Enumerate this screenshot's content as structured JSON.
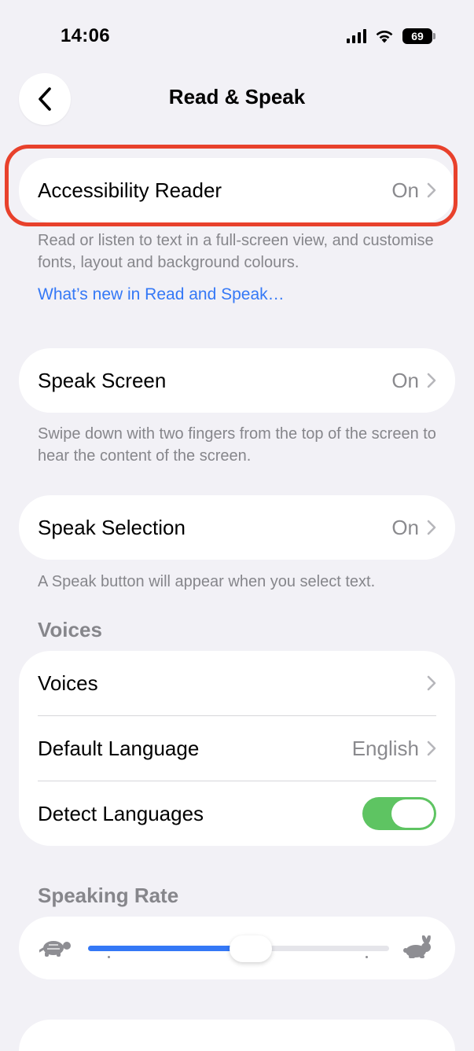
{
  "status": {
    "time": "14:06",
    "battery": "69"
  },
  "nav": {
    "title": "Read & Speak",
    "back_icon": "chevron-left-icon"
  },
  "accessibility_reader": {
    "label": "Accessibility Reader",
    "value": "On",
    "description": "Read or listen to text in a full-screen view, and customise fonts, layout and background colours.",
    "link": "What’s new in Read and Speak…"
  },
  "speak_screen": {
    "label": "Speak Screen",
    "value": "On",
    "description": "Swipe down with two fingers from the top of the screen to hear the content of the screen."
  },
  "speak_selection": {
    "label": "Speak Selection",
    "value": "On",
    "description": "A Speak button will appear when you select text."
  },
  "voices_section": {
    "header": "Voices",
    "voices_label": "Voices",
    "default_language_label": "Default Language",
    "default_language_value": "English",
    "detect_languages_label": "Detect Languages",
    "detect_languages_on": true
  },
  "speaking_rate": {
    "header": "Speaking Rate",
    "value_fraction": 0.54,
    "slow_icon": "turtle-icon",
    "fast_icon": "rabbit-icon"
  },
  "colors": {
    "accent": "#3478f6",
    "toggle_on": "#5ec462",
    "highlight": "#e8412c"
  }
}
